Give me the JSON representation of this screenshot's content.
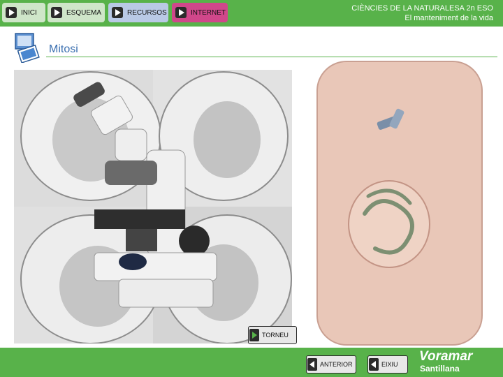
{
  "nav": {
    "items": [
      {
        "label": "INICI"
      },
      {
        "label": "ESQUEMA"
      },
      {
        "label": "RECURSOS"
      },
      {
        "label": "INTERNET"
      }
    ]
  },
  "header": {
    "line1": "CIÈNCIES DE LA NATURALESA 2n ESO",
    "line2": "El manteniment de la vida"
  },
  "page": {
    "title": "Mitosi"
  },
  "buttons": {
    "torneu": "TORNEU",
    "anterior": "ANTERIOR",
    "eixiu": "EIXIU"
  },
  "brand": {
    "name": "Voramar",
    "publisher": "Santillana"
  },
  "colors": {
    "green": "#58b24a",
    "magenta": "#d0478a",
    "title_blue": "#3a6fb0"
  },
  "icons": {
    "section": "document-icon",
    "nav": "play-arrow-icon"
  }
}
